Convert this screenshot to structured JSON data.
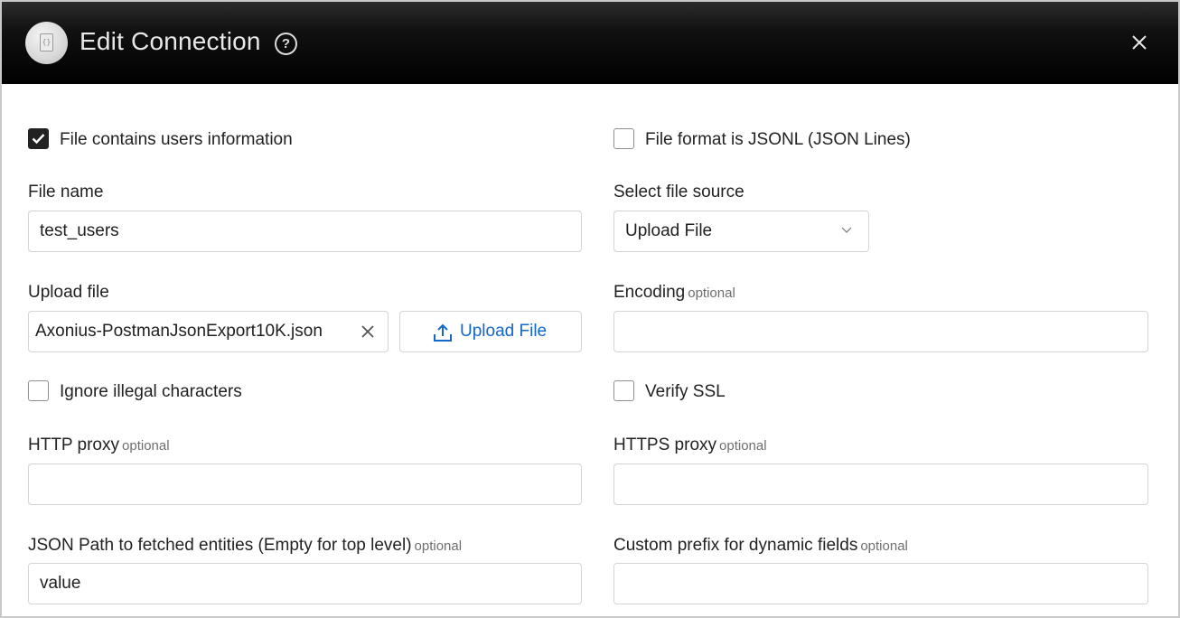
{
  "header": {
    "title": "Edit Connection",
    "help_icon": "help-circle-icon",
    "close_icon": "close-icon",
    "app_icon": "json-file-icon",
    "app_icon_glyph": "{}"
  },
  "form": {
    "file_contains_users": {
      "label": "File contains users information",
      "checked": true
    },
    "file_format_jsonl": {
      "label": "File format is JSONL (JSON Lines)",
      "checked": false
    },
    "file_name": {
      "label": "File name",
      "value": "test_users"
    },
    "select_file_source": {
      "label": "Select file source",
      "value": "Upload File"
    },
    "upload_file": {
      "label": "Upload file",
      "file_value": "Axonius-PostmanJsonExport10K.json",
      "button_label": "Upload File"
    },
    "encoding": {
      "label": "Encoding",
      "optional": "optional",
      "value": ""
    },
    "ignore_illegal_chars": {
      "label": "Ignore illegal characters",
      "checked": false
    },
    "verify_ssl": {
      "label": "Verify SSL",
      "checked": false
    },
    "http_proxy": {
      "label": "HTTP proxy",
      "optional": "optional",
      "value": ""
    },
    "https_proxy": {
      "label": "HTTPS proxy",
      "optional": "optional",
      "value": ""
    },
    "json_path": {
      "label": "JSON Path to fetched entities (Empty for top level)",
      "optional": "optional",
      "value": "value"
    },
    "custom_prefix": {
      "label": "Custom prefix for dynamic fields",
      "optional": "optional",
      "value": ""
    }
  },
  "colors": {
    "header_bg": "#000000",
    "link_blue": "#1467c7",
    "checkbox_checked": "#222222"
  }
}
